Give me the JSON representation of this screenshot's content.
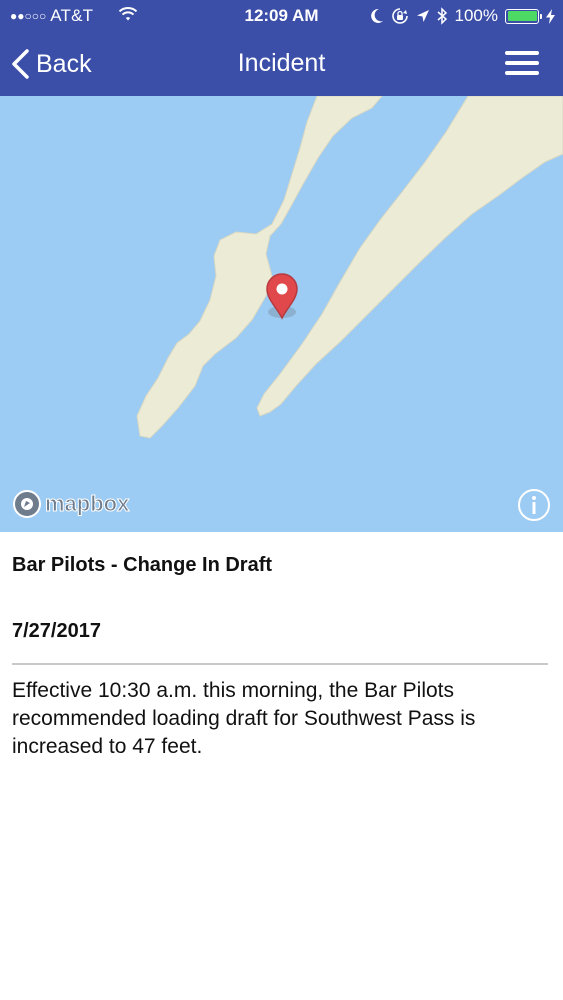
{
  "status_bar": {
    "carrier": "AT&T",
    "signal_dots": "●●○○○",
    "time": "12:09 AM",
    "battery": "100%",
    "battery_level": 1.0,
    "icons": [
      "signal-icon",
      "wifi-icon",
      "moon-icon",
      "orientation-lock-icon",
      "location-icon",
      "bluetooth-icon",
      "battery-icon",
      "charging-icon"
    ]
  },
  "nav": {
    "back_label": "Back",
    "title": "Incident",
    "menu_icon": "hamburger-menu-icon"
  },
  "map": {
    "attribution": "mapbox",
    "marker_icon": "map-pin-icon",
    "info_icon": "info-icon",
    "colors": {
      "water": "#9ccbf3",
      "land": "#ecebd6",
      "marker": "#e0484c"
    }
  },
  "incident": {
    "headline": "Bar Pilots - Change In Draft",
    "date": "7/27/2017",
    "description": "Effective 10:30 a.m. this morning, the Bar Pilots recommended loading draft for Southwest Pass is increased to 47 feet."
  },
  "theme": {
    "header_bg": "#3b4fa8"
  }
}
